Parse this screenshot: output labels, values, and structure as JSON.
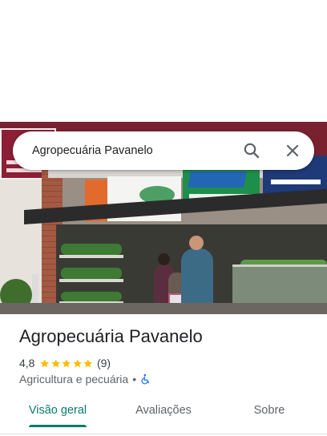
{
  "search": {
    "query": "Agropecuária Pavanelo"
  },
  "place": {
    "name": "Agropecuária Pavanelo",
    "rating": "4,8",
    "stars": 5,
    "review_count": "(9)",
    "category": "Agricultura e pecuária",
    "separator": "•"
  },
  "tabs": [
    {
      "label": "Visão geral",
      "active": true
    },
    {
      "label": "Avaliações",
      "active": false
    },
    {
      "label": "Sobre",
      "active": false
    }
  ],
  "colors": {
    "accent": "#0b7a6e",
    "star": "#fbbc04",
    "wheelchair": "#1a73e8"
  },
  "icons": {
    "search": "search-icon",
    "close": "close-icon",
    "star": "star-icon",
    "accessibility": "wheelchair-icon"
  }
}
